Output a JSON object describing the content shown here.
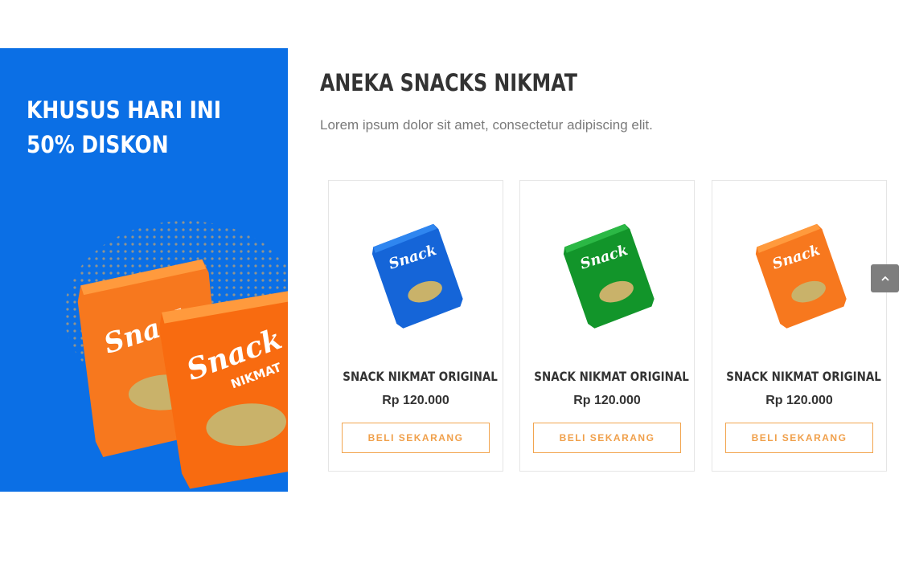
{
  "promo": {
    "line1": "KHUSUS HARI INI",
    "line2": "50% DISKON",
    "background": "#0b6fe5",
    "bag_brand": "Snack",
    "bag_sub": "NIKMAT"
  },
  "section": {
    "title": "ANEKA SNACKS NIKMAT",
    "subtitle": "Lorem ipsum dolor sit amet, consectetur adipiscing elit."
  },
  "products": [
    {
      "name": "SNACK NIKMAT ORIGINAL",
      "price": "Rp 120.000",
      "button": "BELI SEKARANG",
      "bag_color": "#1565d8"
    },
    {
      "name": "SNACK NIKMAT ORIGINAL",
      "price": "Rp 120.000",
      "button": "BELI SEKARANG",
      "bag_color": "#12952a"
    },
    {
      "name": "SNACK NIKMAT ORIGINAL",
      "price": "Rp 120.000",
      "button": "BELI SEKARANG",
      "bag_color": "#f7781e"
    }
  ],
  "scroll_top": {
    "icon": "chevron-up-icon"
  },
  "colors": {
    "accent": "#f0a04b",
    "text": "#333333"
  }
}
